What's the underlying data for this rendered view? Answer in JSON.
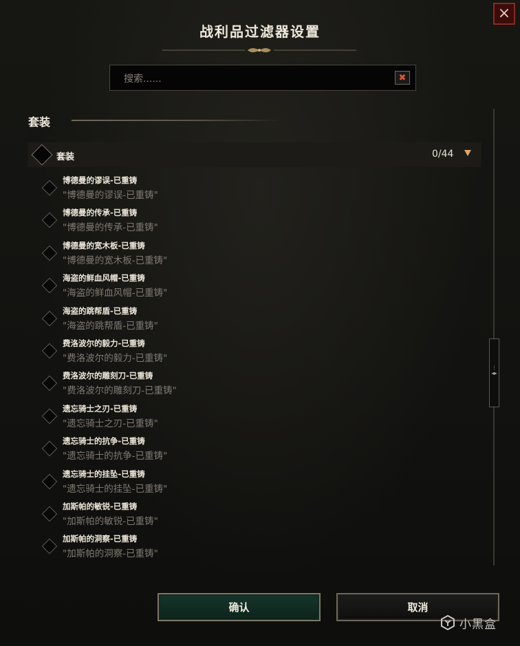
{
  "dialog": {
    "title": "战利品过滤器设置",
    "close_icon": "×"
  },
  "search": {
    "placeholder": "搜索......",
    "value": "",
    "clear_icon": "✖"
  },
  "section": {
    "title": "套装"
  },
  "group": {
    "label": "套装",
    "count": "0/44",
    "selected": false
  },
  "items": [
    {
      "name": "博德曼的谬误-已重铸",
      "sub": "\"博德曼的谬误-已重铸\""
    },
    {
      "name": "博德曼的传承-已重铸",
      "sub": "\"博德曼的传承-已重铸\""
    },
    {
      "name": "博德曼的宽木板-已重铸",
      "sub": "\"博德曼的宽木板-已重铸\""
    },
    {
      "name": "海盗的鲜血风帽-已重铸",
      "sub": "\"海盗的鲜血风帽-已重铸\""
    },
    {
      "name": "海盗的跳帮盾-已重铸",
      "sub": "\"海盗的跳帮盾-已重铸\""
    },
    {
      "name": "费洛波尔的毅力-已重铸",
      "sub": "\"费洛波尔的毅力-已重铸\""
    },
    {
      "name": "费洛波尔的雕刻刀-已重铸",
      "sub": "\"费洛波尔的雕刻刀-已重铸\""
    },
    {
      "name": "遗忘骑士之刃-已重铸",
      "sub": "\"遗忘骑士之刃-已重铸\""
    },
    {
      "name": "遗忘骑士的抗争-已重铸",
      "sub": "\"遗忘骑士的抗争-已重铸\""
    },
    {
      "name": "遗忘骑士的挂坠-已重铸",
      "sub": "\"遗忘骑士的挂坠-已重铸\""
    },
    {
      "name": "加斯帕的敏锐-已重铸",
      "sub": "\"加斯帕的敏锐-已重铸\""
    },
    {
      "name": "加斯帕的洞察-已重铸",
      "sub": "\"加斯帕的洞察-已重铸\""
    }
  ],
  "buttons": {
    "confirm": "确认",
    "cancel": "取消"
  },
  "watermark": {
    "text": "小黑盒"
  },
  "colors": {
    "confirm_bg": "#16352b",
    "close_bg": "#3a0d0b",
    "toggle_arrow": "#e0a56a"
  }
}
